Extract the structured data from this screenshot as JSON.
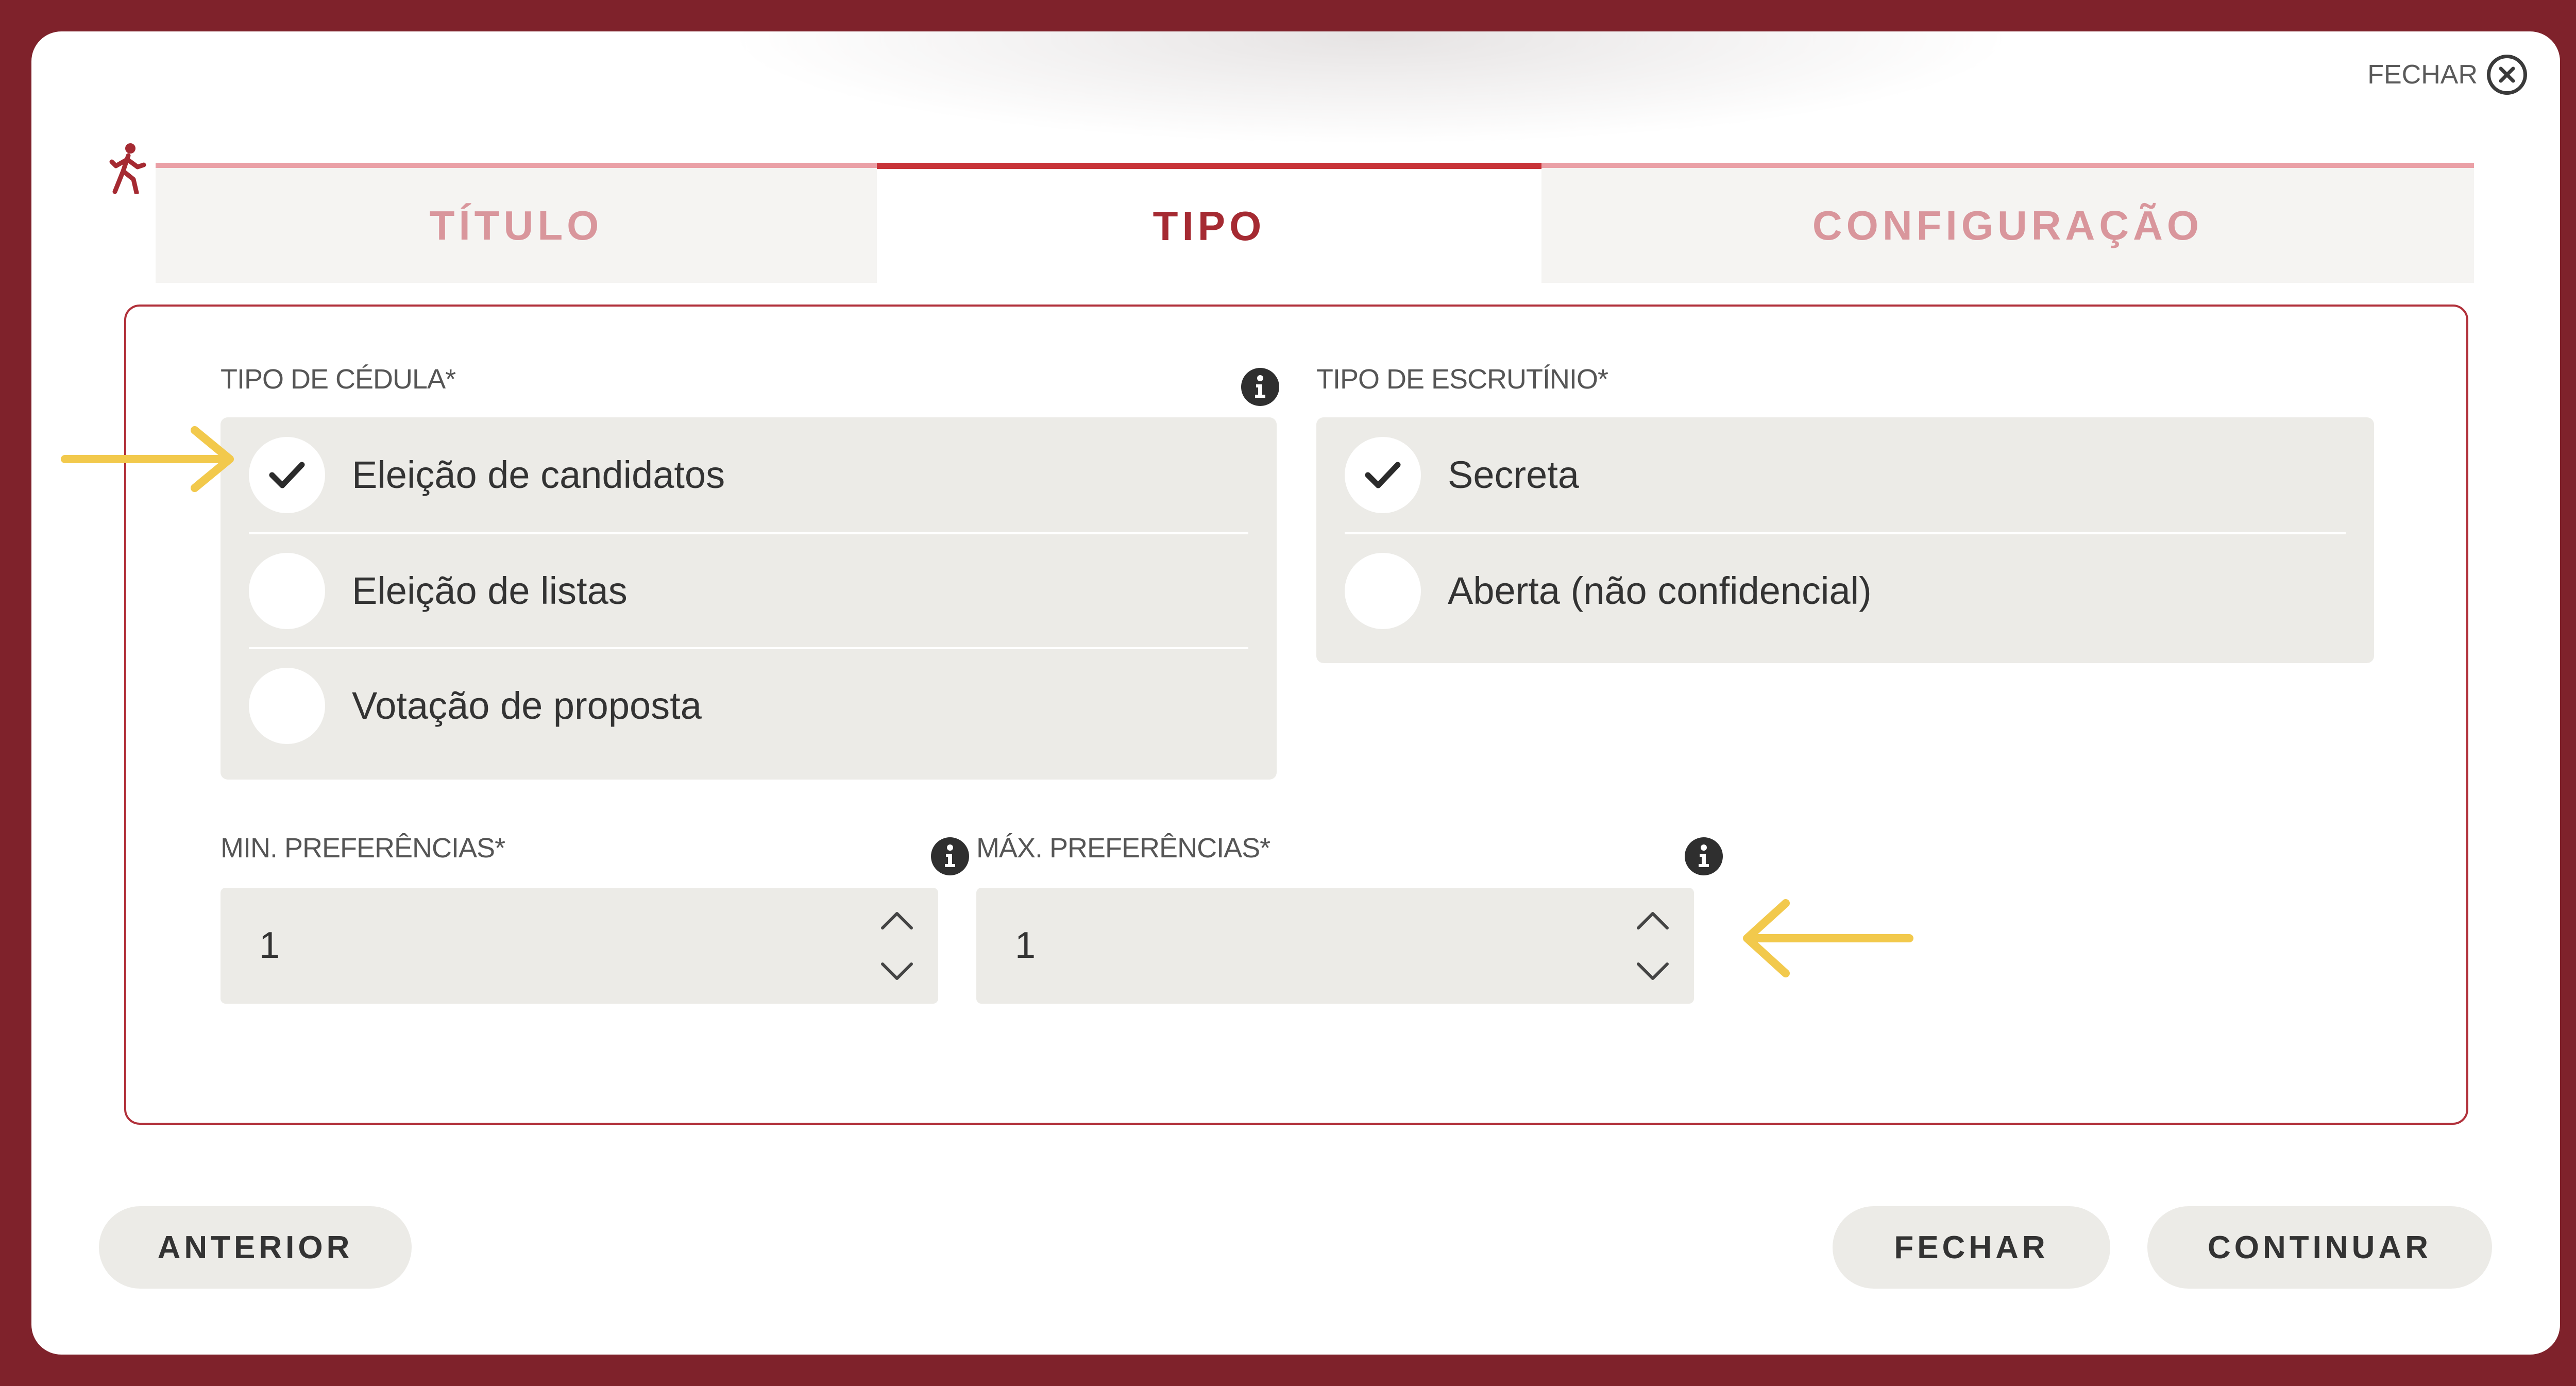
{
  "header": {
    "close_label": "FECHAR"
  },
  "tabs": [
    {
      "label": "TÍTULO"
    },
    {
      "label": "TIPO"
    },
    {
      "label": "CONFIGURAÇÃO"
    }
  ],
  "ballot": {
    "label": "TIPO DE CÉDULA*",
    "options": [
      {
        "label": "Eleição de candidatos",
        "selected": true
      },
      {
        "label": "Eleição de listas",
        "selected": false
      },
      {
        "label": "Votação de proposta",
        "selected": false
      }
    ]
  },
  "scrutiny": {
    "label": "TIPO DE ESCRUTÍNIO*",
    "options": [
      {
        "label": "Secreta",
        "selected": true
      },
      {
        "label": "Aberta (não confidencial)",
        "selected": false
      }
    ]
  },
  "min_pref": {
    "label": "MIN. PREFERÊNCIAS*",
    "value": "1"
  },
  "max_pref": {
    "label": "MÁX. PREFERÊNCIAS*",
    "value": "1"
  },
  "footer": {
    "back_label": "ANTERIOR",
    "close_label": "FECHAR",
    "continue_label": "CONTINUAR"
  },
  "colors": {
    "frame": "#7f222b",
    "accent": "#c83338",
    "annotation_arrow": "#f2c94c"
  },
  "icons": [
    "close-icon",
    "walking-person-icon",
    "info-icon",
    "checkmark-icon",
    "chevron-up-icon",
    "chevron-down-icon",
    "arrow-right-icon",
    "arrow-left-icon"
  ]
}
